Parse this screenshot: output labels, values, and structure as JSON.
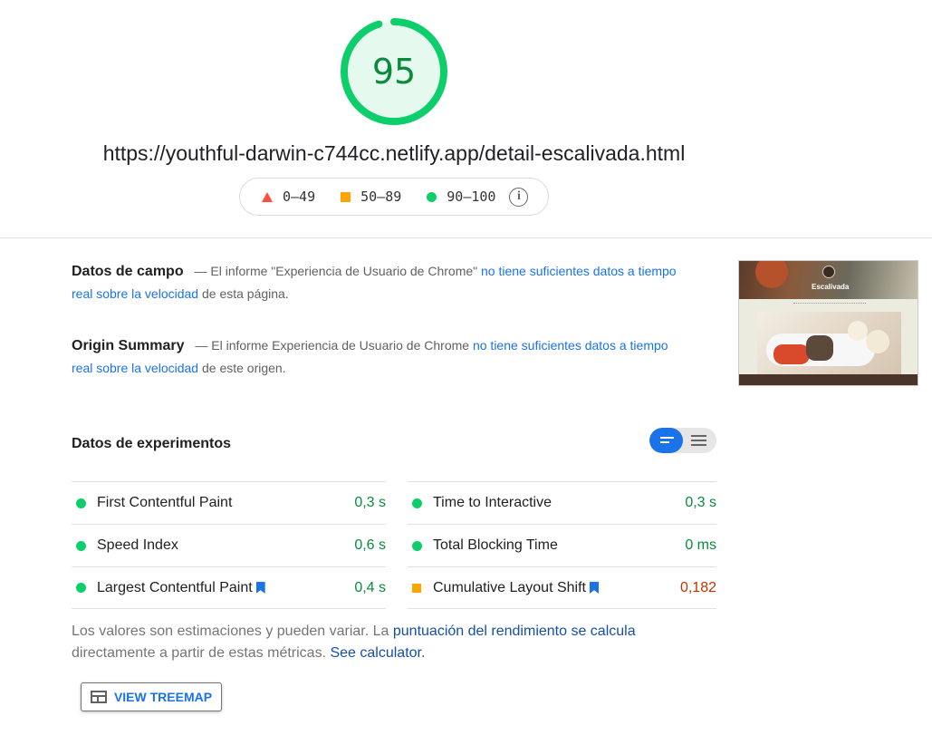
{
  "score": {
    "value": "95",
    "color": "#0cce6b"
  },
  "url": "https://youthful-darwin-c744cc.netlify.app/detail-escalivada.html",
  "legend": [
    {
      "shape": "triangle",
      "color": "#ff4e42",
      "label": "0–49"
    },
    {
      "shape": "square",
      "color": "#ffa400",
      "label": "50–89"
    },
    {
      "shape": "circle",
      "color": "#0cce6b",
      "label": "90–100"
    }
  ],
  "legend_info_icon": "info-icon",
  "field_data": {
    "title": "Datos de campo",
    "text_before": "— El informe \"Experiencia de Usuario de Chrome\"",
    "link": "no tiene suficientes datos a tiempo real sobre la velocidad",
    "text_after": "de esta página."
  },
  "origin_summary": {
    "title": "Origin Summary",
    "text_before": "— El informe Experiencia de Usuario de Chrome",
    "link": "no tiene suficientes datos a tiempo real sobre la velocidad",
    "text_after": "de este origen."
  },
  "thumbnail": {
    "title": "Escalivada"
  },
  "experiments": {
    "title": "Datos de experimentos",
    "metrics_left": [
      {
        "name": "First Contentful Paint",
        "value": "0,3 s",
        "status": "good",
        "bookmark": false
      },
      {
        "name": "Speed Index",
        "value": "0,6 s",
        "status": "good",
        "bookmark": false
      },
      {
        "name": "Largest Contentful Paint",
        "value": "0,4 s",
        "status": "good",
        "bookmark": true
      }
    ],
    "metrics_right": [
      {
        "name": "Time to Interactive",
        "value": "0,3 s",
        "status": "good",
        "bookmark": false
      },
      {
        "name": "Total Blocking Time",
        "value": "0 ms",
        "status": "good",
        "bookmark": false
      },
      {
        "name": "Cumulative Layout Shift",
        "value": "0,182",
        "status": "average",
        "bookmark": true
      }
    ]
  },
  "note": {
    "text1": "Los valores son estimaciones y pueden variar. La",
    "link1": "puntuación del rendimiento se calcula",
    "text2": "directamente a partir de estas métricas.",
    "link2": "See calculator."
  },
  "treemap_button": {
    "label": "VIEW TREEMAP",
    "icon": "treemap-icon"
  }
}
